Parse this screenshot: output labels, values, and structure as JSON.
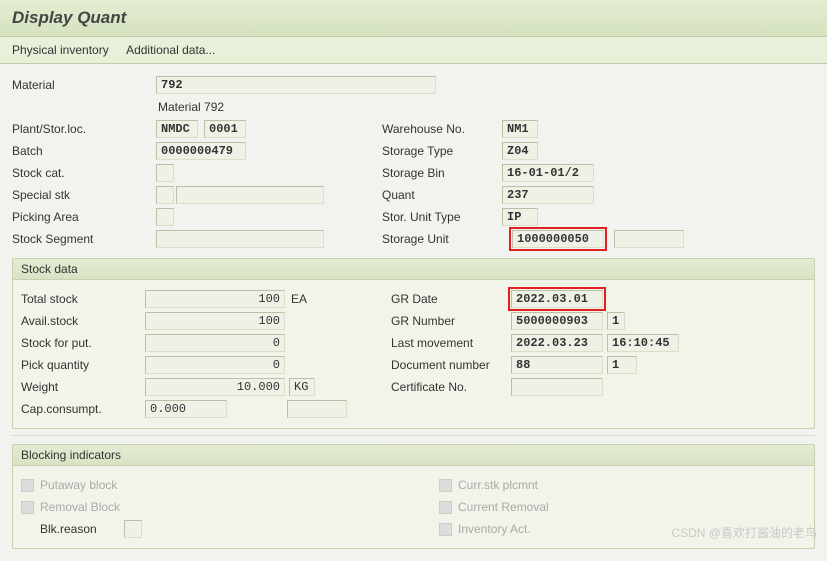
{
  "title": "Display Quant",
  "menu": {
    "physical_inventory": "Physical inventory",
    "additional_data": "Additional data..."
  },
  "header": {
    "material_label": "Material",
    "material": "792",
    "material_text": "Material 792",
    "plant_label": "Plant/Stor.loc.",
    "plant": "NMDC",
    "sloc": "0001",
    "batch_label": "Batch",
    "batch": "0000000479",
    "stock_cat_label": "Stock cat.",
    "stock_cat": "",
    "special_stk_label": "Special stk",
    "special_stk": "",
    "special_stk2": "",
    "picking_area_label": "Picking Area",
    "picking_area": "",
    "stock_segment_label": "Stock Segment",
    "stock_segment": "",
    "warehouse_label": "Warehouse No.",
    "warehouse": "NM1",
    "storage_type_label": "Storage Type",
    "storage_type": "Z04",
    "storage_bin_label": "Storage Bin",
    "storage_bin": "16-01-01/2",
    "quant_label": "Quant",
    "quant": "237",
    "stor_unit_type_label": "Stor. Unit Type",
    "stor_unit_type": "IP",
    "storage_unit_label": "Storage Unit",
    "storage_unit": "1000000050"
  },
  "stock_data": {
    "title": "Stock data",
    "total_stock_label": "Total stock",
    "total_stock": "100",
    "uom": "EA",
    "avail_stock_label": "Avail.stock",
    "avail_stock": "100",
    "stock_for_put_label": "Stock for put.",
    "stock_for_put": "0",
    "pick_qty_label": "Pick quantity",
    "pick_qty": "0",
    "weight_label": "Weight",
    "weight": "10.000",
    "weight_uom": "KG",
    "cap_label": "Cap.consumpt.",
    "cap": "0.000",
    "gr_date_label": "GR Date",
    "gr_date": "2022.03.01",
    "gr_number_label": "GR Number",
    "gr_number": "5000000903",
    "gr_item": "1",
    "last_mvmt_label": "Last movement",
    "last_mvmt_date": "2022.03.23",
    "last_mvmt_time": "16:10:45",
    "doc_number_label": "Document number",
    "doc_number": "88",
    "doc_item": "1",
    "cert_label": "Certificate No.",
    "cert": ""
  },
  "blocking": {
    "title": "Blocking indicators",
    "putaway_label": "Putaway block",
    "removal_label": "Removal Block",
    "blk_reason_label": "Blk.reason",
    "blk_reason": "",
    "curr_stk_label": "Curr.stk plcmnt",
    "curr_rem_label": "Current Removal",
    "inv_act_label": "Inventory Act."
  },
  "watermark": "CSDN @喜欢打酱油的老鸟"
}
